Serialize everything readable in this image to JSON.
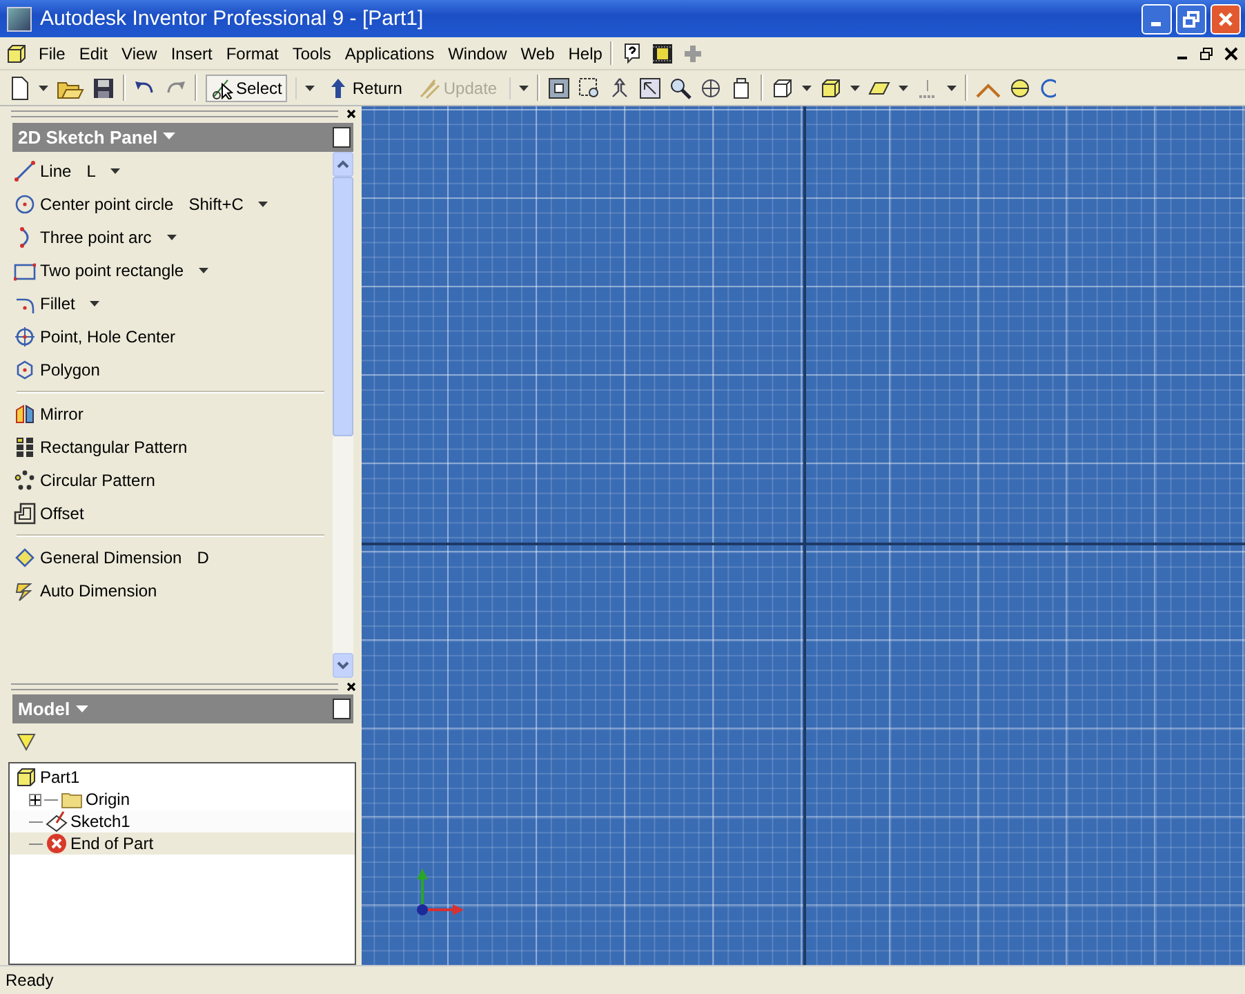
{
  "window": {
    "title": "Autodesk Inventor Professional 9 - [Part1]"
  },
  "menu": [
    "File",
    "Edit",
    "View",
    "Insert",
    "Format",
    "Tools",
    "Applications",
    "Window",
    "Web",
    "Help"
  ],
  "toolbar": {
    "buttons": [
      {
        "label": "Select",
        "dropdown": true,
        "disabled": false
      },
      {
        "label": "Return",
        "dropdown": false,
        "disabled": false
      },
      {
        "label": "Update",
        "dropdown": true,
        "disabled": true
      }
    ]
  },
  "sketch_panel": {
    "title": "2D Sketch Panel",
    "groups": [
      [
        {
          "label": "Line",
          "shortcut": "L",
          "dropdown": true
        },
        {
          "label": "Center point circle",
          "shortcut": "Shift+C",
          "dropdown": true
        },
        {
          "label": "Three point arc",
          "dropdown": true
        },
        {
          "label": "Two point rectangle",
          "dropdown": true
        },
        {
          "label": "Fillet",
          "dropdown": true
        },
        {
          "label": "Point, Hole Center",
          "dropdown": false
        },
        {
          "label": "Polygon",
          "dropdown": false
        }
      ],
      [
        {
          "label": "Mirror",
          "dropdown": false
        },
        {
          "label": "Rectangular Pattern",
          "dropdown": false
        },
        {
          "label": "Circular Pattern",
          "dropdown": false
        },
        {
          "label": "Offset",
          "dropdown": false
        }
      ],
      [
        {
          "label": "General Dimension",
          "shortcut": "D",
          "dropdown": false
        },
        {
          "label": "Auto Dimension",
          "dropdown": false
        }
      ]
    ]
  },
  "model_panel": {
    "title": "Model",
    "tree": [
      {
        "label": "Part1",
        "kind": "part",
        "expanded": true,
        "children": [
          {
            "label": "Origin",
            "kind": "folder",
            "expanded": false
          },
          {
            "label": "Sketch1",
            "kind": "sketch",
            "selected": true
          },
          {
            "label": "End of Part",
            "kind": "end"
          }
        ]
      }
    ]
  },
  "status_bar": "Ready"
}
